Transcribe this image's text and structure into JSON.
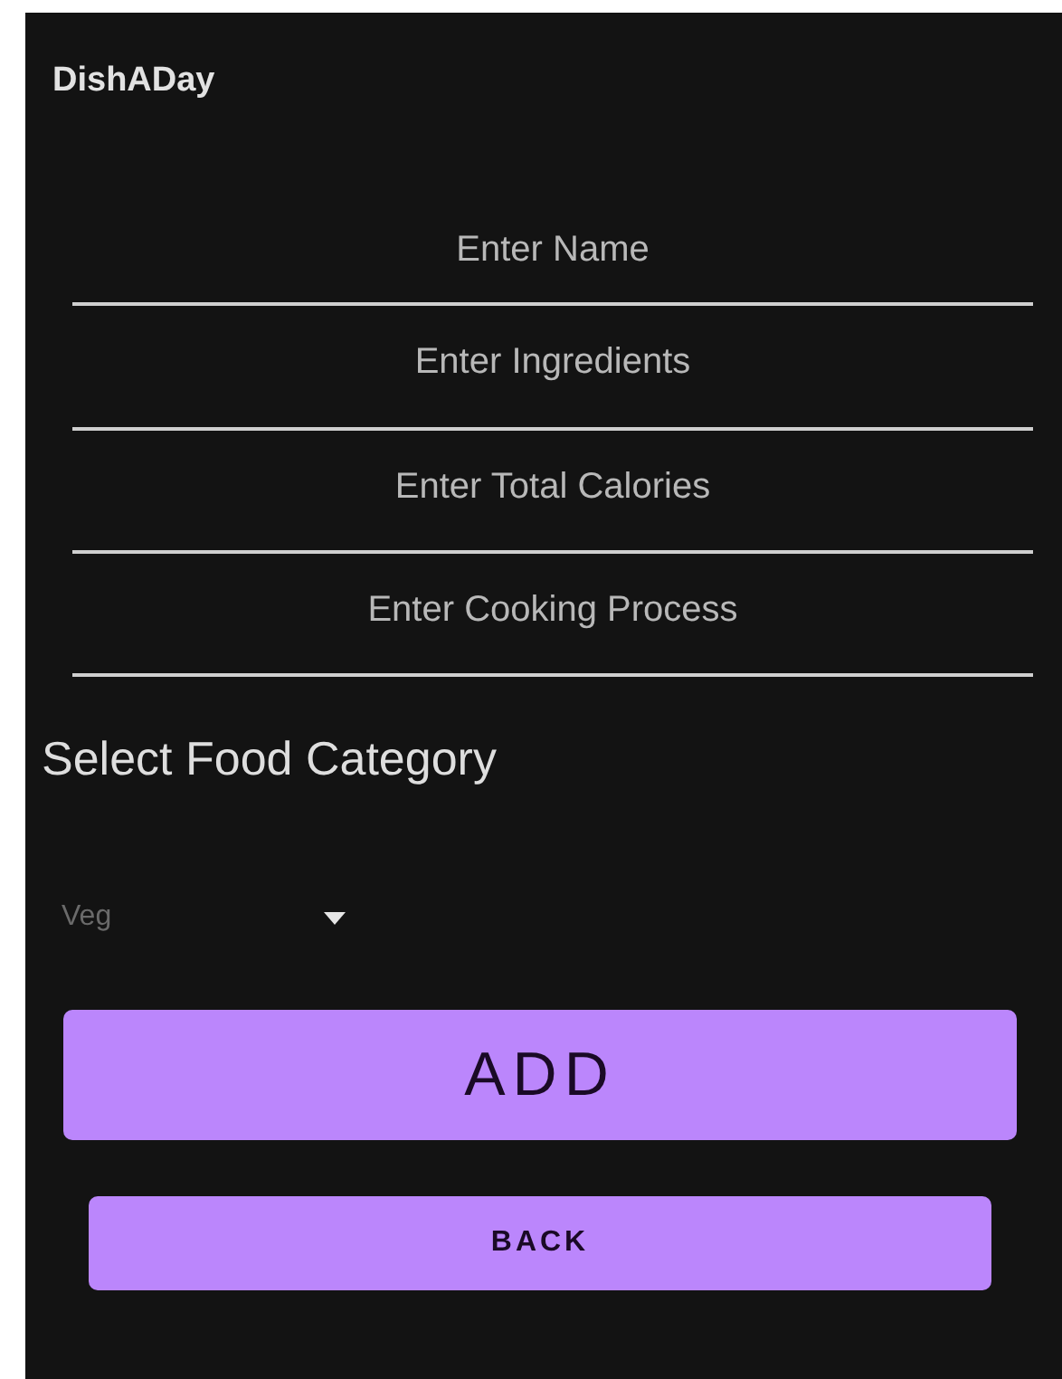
{
  "app_bar": {
    "title": "DishADay"
  },
  "fields": [
    {
      "placeholder": "Enter Name"
    },
    {
      "placeholder": "Enter Ingredients"
    },
    {
      "placeholder": "Enter Total Calories"
    },
    {
      "placeholder": "Enter Cooking Process"
    }
  ],
  "category": {
    "label": "Select Food Category",
    "value": "Veg",
    "disabled": true
  },
  "buttons": [
    {
      "label": "ADD",
      "kind": "primary"
    },
    {
      "label": "BACK",
      "kind": "secondary"
    }
  ]
}
